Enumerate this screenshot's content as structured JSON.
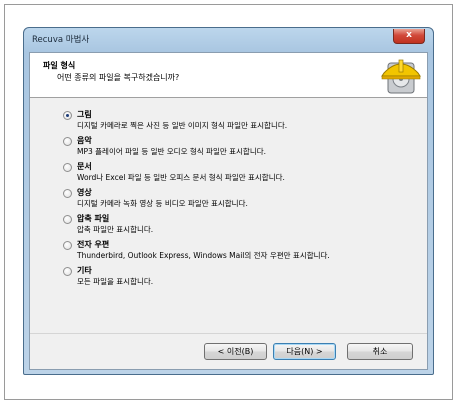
{
  "window": {
    "title": "Recuva 마법사",
    "close_glyph": "x"
  },
  "header": {
    "title": "파일 형식",
    "subtitle": "어떤 종류의 파일을 복구하겠습니까?",
    "art_icon": "recuva-hardhat-drive-icon"
  },
  "options": [
    {
      "label": "그림",
      "description": "디지털 카메라로 찍은 사진 등 일반 이미지 형식 파일만 표시합니다.",
      "selected": true
    },
    {
      "label": "음악",
      "description": "MP3 플레이어 파일 등 일반 오디오 형식 파일만 표시합니다.",
      "selected": false
    },
    {
      "label": "문서",
      "description": "Word나 Excel 파일 등 일반 오피스 문서 형식 파일만 표시합니다.",
      "selected": false
    },
    {
      "label": "영상",
      "description": "디지털 카메라 녹화 영상 등 비디오 파일만 표시합니다.",
      "selected": false
    },
    {
      "label": "압축 파일",
      "description": "압축 파일만 표시합니다.",
      "selected": false
    },
    {
      "label": "전자 우편",
      "description": "Thunderbird, Outlook Express, Windows Mail의 전자 우편만 표시합니다.",
      "selected": false
    },
    {
      "label": "기타",
      "description": "모든 파일을 표시합니다.",
      "selected": false
    }
  ],
  "buttons": {
    "back": "< 이전(B)",
    "next": "다음(N) >",
    "cancel": "취소"
  }
}
